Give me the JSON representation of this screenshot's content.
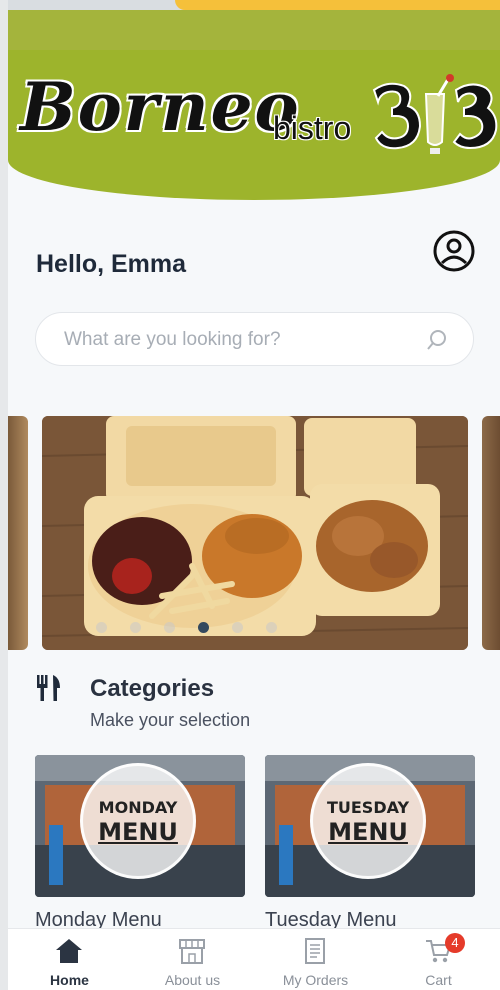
{
  "brand": {
    "logo_text": "Borneo",
    "logo_sub": "bistro",
    "colors": {
      "header_green": "#9db42c",
      "accent_yellow": "#f5c03a",
      "badge_red": "#e53b2a",
      "text_dark": "#1f2a3a"
    }
  },
  "greeting": {
    "text": "Hello, Emma"
  },
  "profile": {
    "icon": "user-circle-icon"
  },
  "search": {
    "placeholder": "What are you looking for?",
    "icon": "search-icon"
  },
  "carousel": {
    "slide_count": 6,
    "active_index": 3
  },
  "categories": {
    "icon": "fork-knife-icon",
    "title": "Categories",
    "subtitle": "Make your selection",
    "items": [
      {
        "image_line1": "MONDAY",
        "image_line2": "MENU",
        "caption": "Monday Menu"
      },
      {
        "image_line1": "TUESDAY",
        "image_line2": "MENU",
        "caption": "Tuesday Menu"
      }
    ]
  },
  "bottom_nav": {
    "items": [
      {
        "label": "Home",
        "icon": "home-icon",
        "active": true
      },
      {
        "label": "About us",
        "icon": "store-icon",
        "active": false
      },
      {
        "label": "My Orders",
        "icon": "orders-icon",
        "active": false
      },
      {
        "label": "Cart",
        "icon": "cart-icon",
        "active": false,
        "badge": "4"
      }
    ]
  }
}
